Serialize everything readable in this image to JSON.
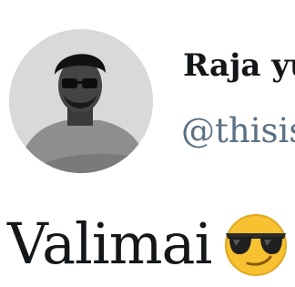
{
  "tweet": {
    "author": {
      "display_name": "Raja yu",
      "handle": "@thisis"
    },
    "text": "Valimai",
    "emoji": "sunglasses-emoji"
  },
  "colors": {
    "name_text": "#14171a",
    "handle_text": "#5b7083",
    "emoji_face": "#f7c132",
    "avatar_bg": "#d8d8d8"
  }
}
